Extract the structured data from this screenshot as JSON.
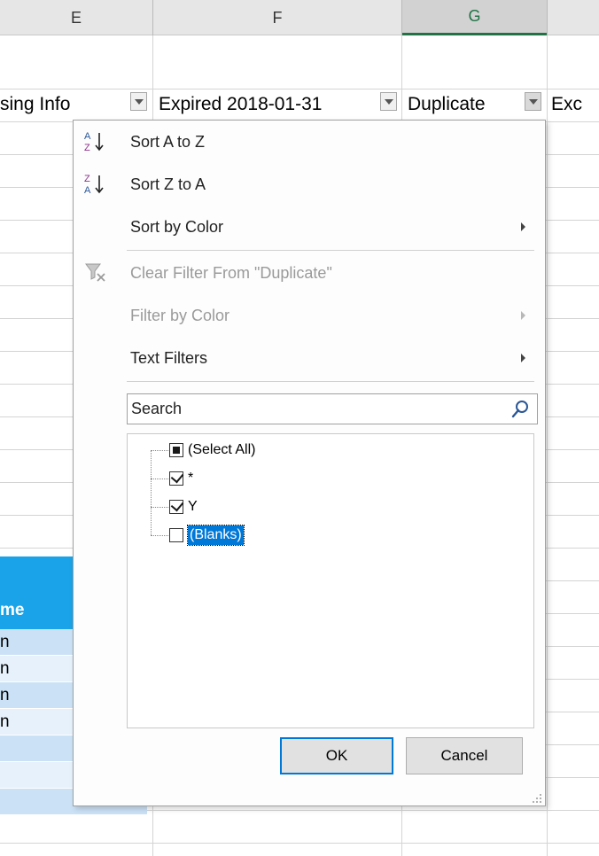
{
  "columns": [
    {
      "letter": "E",
      "selected": false
    },
    {
      "letter": "F",
      "selected": false
    },
    {
      "letter": "G",
      "selected": true
    }
  ],
  "header_row": {
    "col_e": "sing Info",
    "col_f": "Expired 2018-01-31",
    "col_g": "Duplicate",
    "col_h": "Exc"
  },
  "table": {
    "header_label": "me",
    "rows": [
      "n",
      "n",
      "n",
      "n",
      "",
      "",
      ""
    ]
  },
  "filter_menu": {
    "sort_az": "Sort A to Z",
    "sort_za": "Sort Z to A",
    "sort_by_color": "Sort by Color",
    "clear_filter": "Clear Filter From \"Duplicate\"",
    "filter_by_color": "Filter by Color",
    "text_filters": "Text Filters",
    "search_placeholder": "Search",
    "items": [
      {
        "label": "(Select All)",
        "state": "partial"
      },
      {
        "label": "*",
        "state": "checked"
      },
      {
        "label": "Y",
        "state": "checked"
      },
      {
        "label": "(Blanks)",
        "state": "unchecked"
      }
    ],
    "ok_label": "OK",
    "cancel_label": "Cancel"
  },
  "colors": {
    "accent": "#217346",
    "table_header": "#1aa3e8",
    "focus_blue": "#0078d7"
  },
  "icons": {
    "sort_az": "sort-ascending-icon",
    "sort_za": "sort-descending-icon",
    "clear_filter": "clear-filter-icon",
    "search": "search-icon"
  }
}
